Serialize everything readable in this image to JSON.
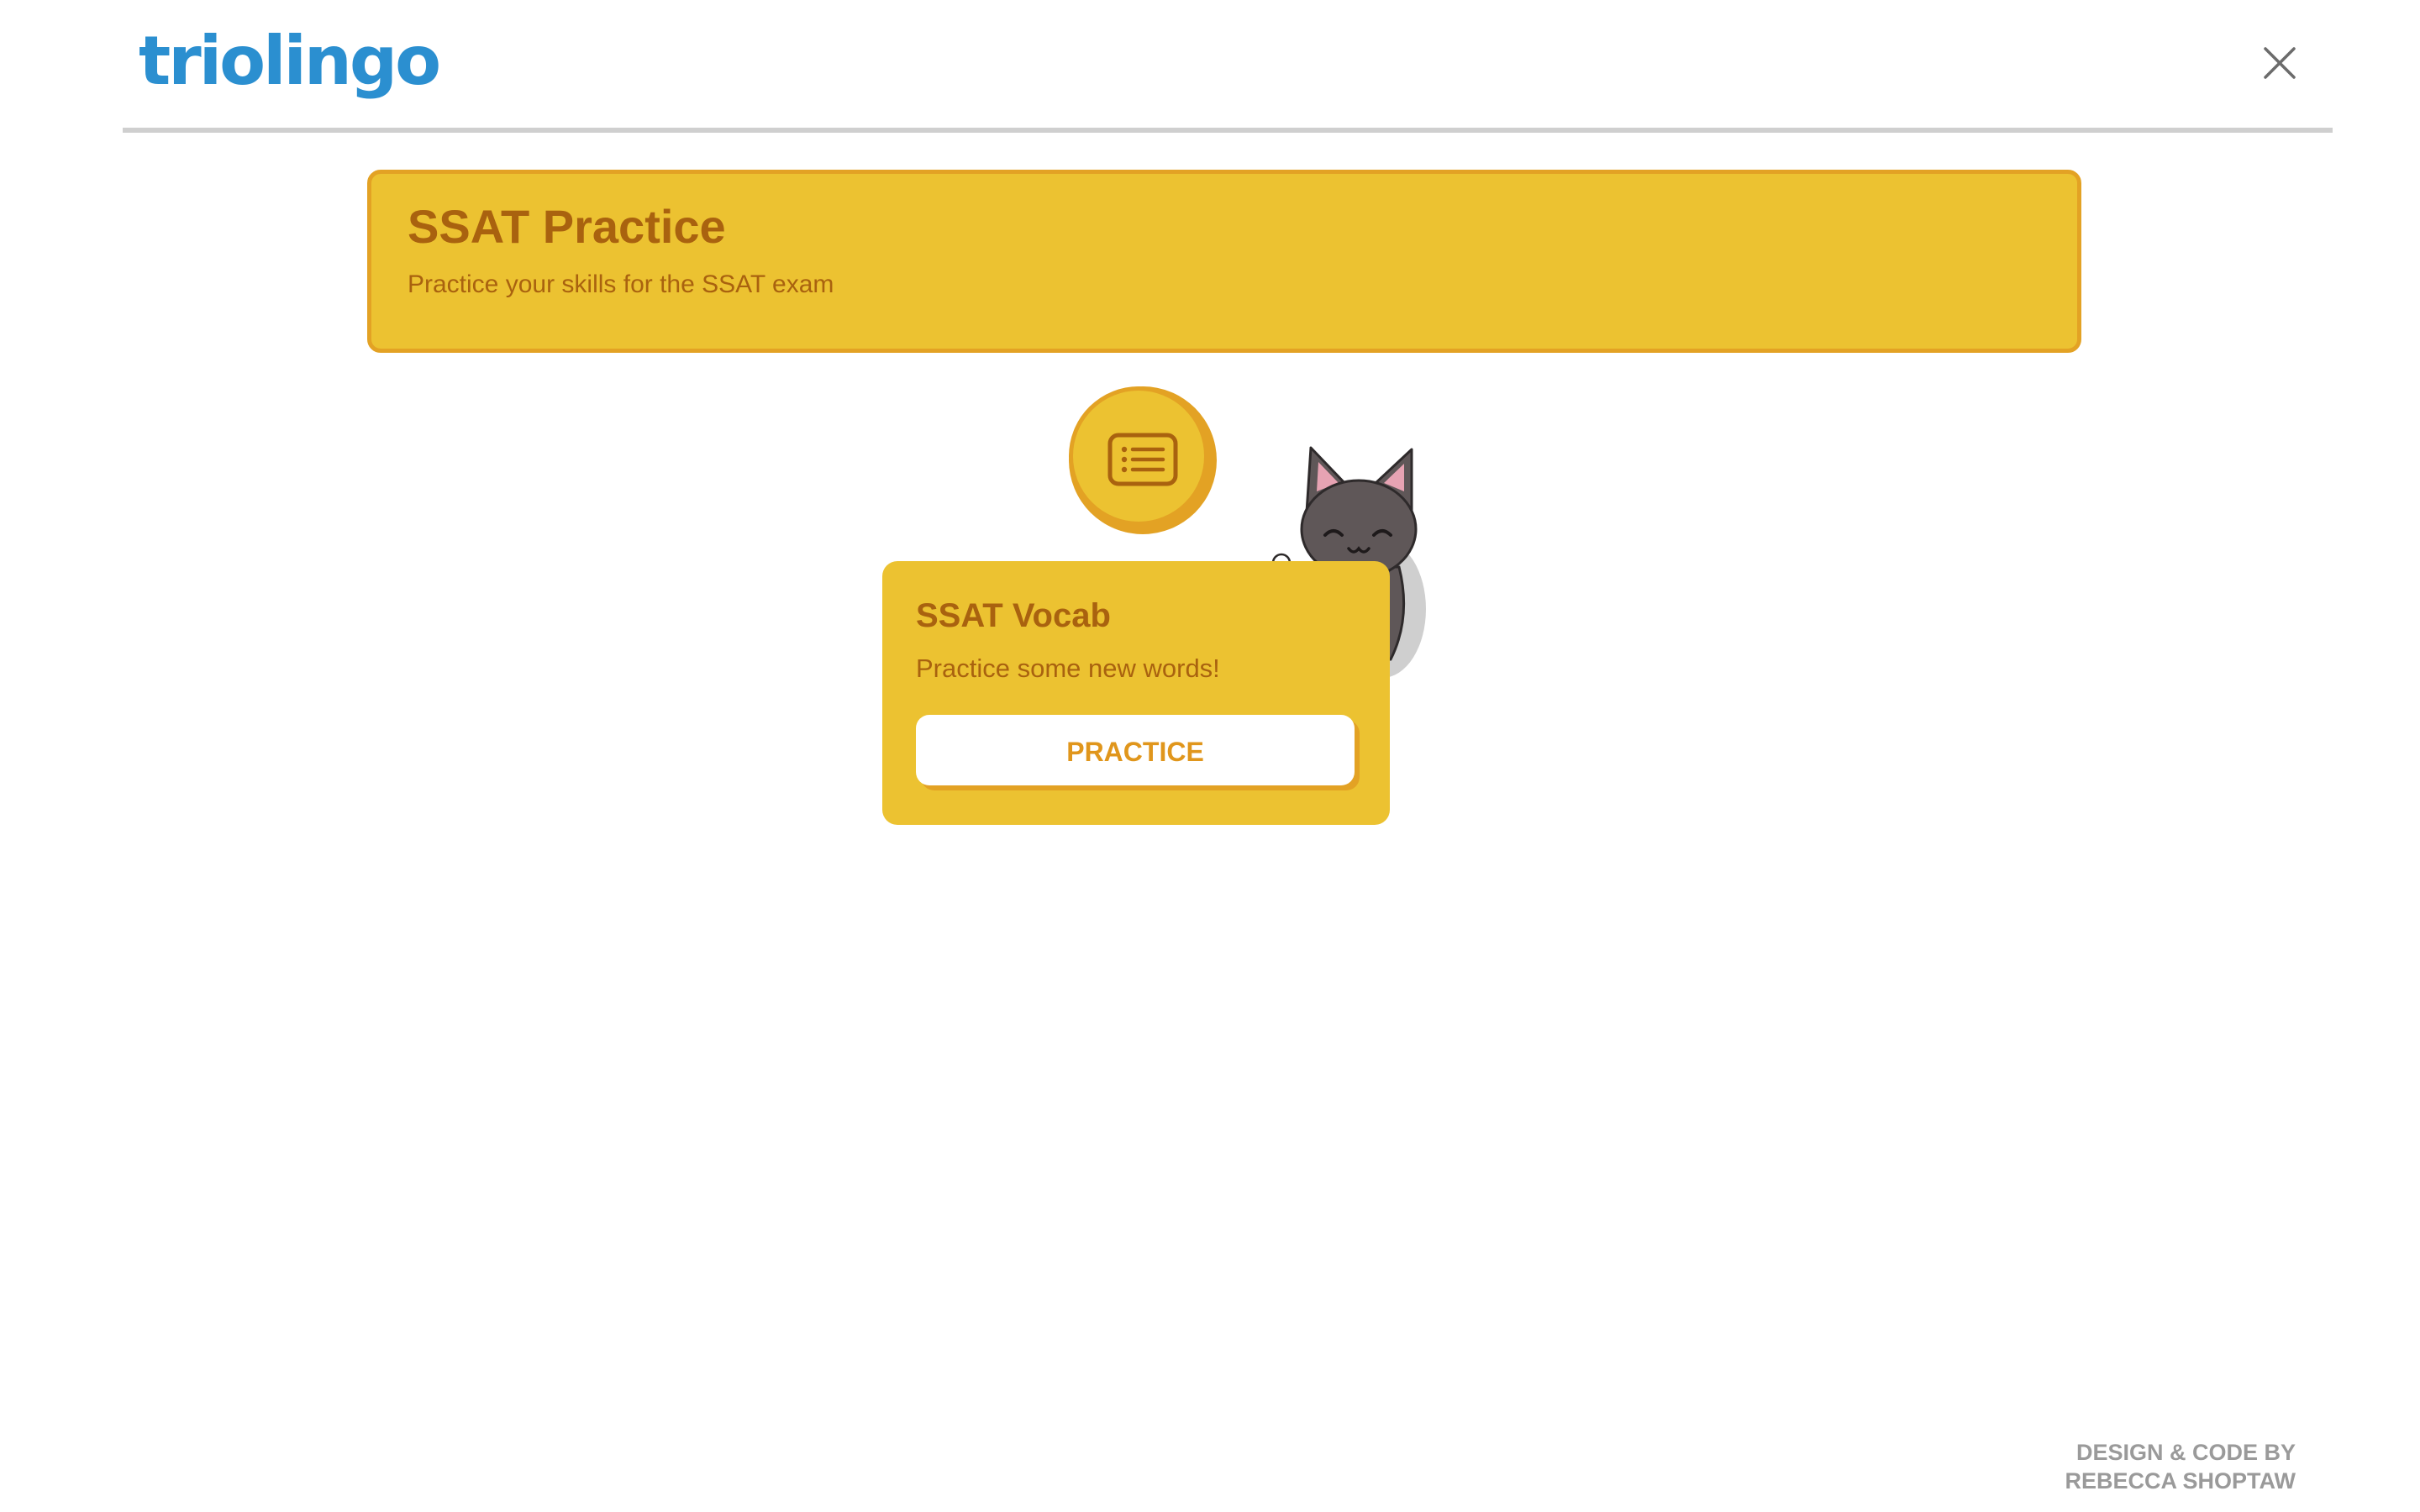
{
  "header": {
    "logo_text": "triolingo",
    "close_icon": "close-icon"
  },
  "banner": {
    "title": "SSAT Practice",
    "subtitle": "Practice your skills for the SSAT exam"
  },
  "lesson_node": {
    "icon": "list-icon"
  },
  "lesson_card": {
    "title": "SSAT Vocab",
    "subtitle": "Practice some new words!",
    "button_label": "PRACTICE"
  },
  "footer": {
    "credit_line1": "DESIGN & CODE BY",
    "credit_line2": "REBECCA SHOPTAW"
  },
  "colors": {
    "brand_blue": "#2b8fd0",
    "accent_yellow": "#ecc231",
    "accent_orange": "#e3a224",
    "text_brown": "#a9620f"
  }
}
